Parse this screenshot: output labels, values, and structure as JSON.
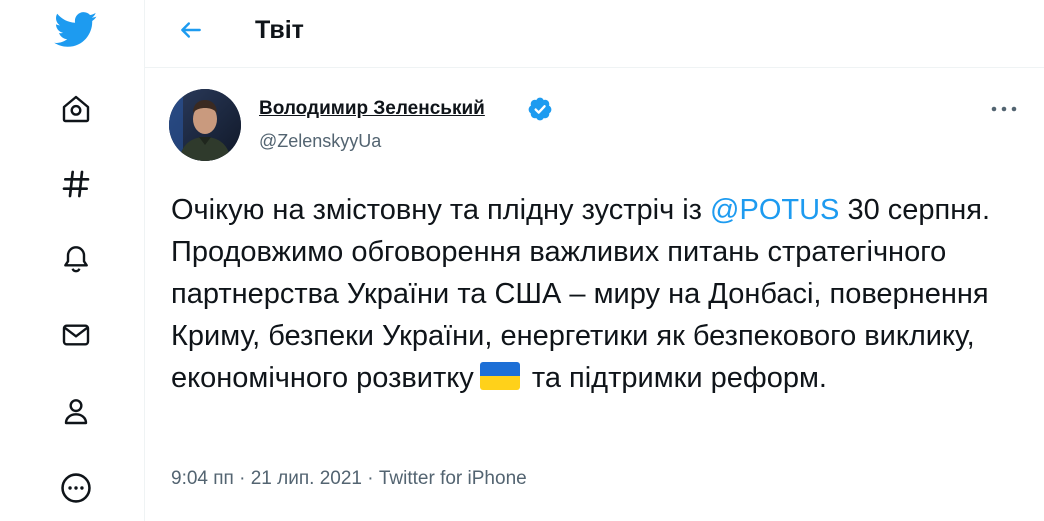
{
  "colors": {
    "brand": "#1d9bf0",
    "text": "#0f1419",
    "muted": "#536471",
    "flag_blue": "#1d6fd6",
    "flag_yellow": "#ffd11a"
  },
  "sidebar": {
    "items": [
      {
        "icon": "twitter-bird-icon"
      },
      {
        "icon": "home-icon"
      },
      {
        "icon": "hashtag-icon"
      },
      {
        "icon": "bell-icon"
      },
      {
        "icon": "mail-icon"
      },
      {
        "icon": "profile-icon"
      },
      {
        "icon": "more-circle-icon"
      }
    ]
  },
  "header": {
    "back_icon": "arrow-left-icon",
    "title": "Твіт"
  },
  "tweet": {
    "author_name": "Володимир Зеленський",
    "handle": "@ZelenskyyUa",
    "verified": true,
    "text_part1": "Очікую на змістовну та плідну зустріч із ",
    "mention": "@POTUS",
    "text_part2": " 30 серпня. Продовжимо обговорення важливих питань стратегічного партнерства України та США – миру на Донбасі, повернення Криму, безпеки України, енергетики як безпекового виклику, економічного розвитку",
    "flag_emoji": "ukraine-flag-icon",
    "text_part3": " та підтримки реформ.",
    "time": "9:04 пп",
    "separator1": " · ",
    "date": "21 лип. 2021",
    "separator2": " · ",
    "source": "Twitter for iPhone"
  }
}
